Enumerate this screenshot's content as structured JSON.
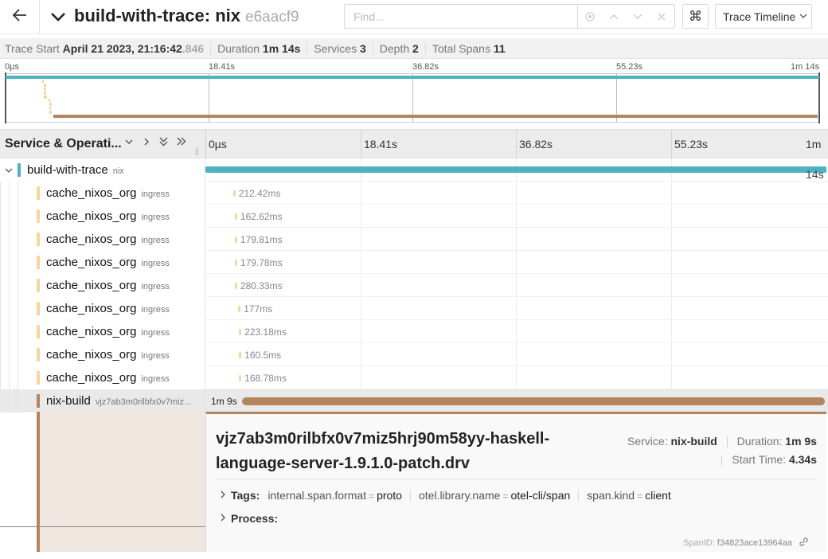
{
  "header": {
    "trace_name": "build-with-trace: nix",
    "trace_id": "e6aacf9",
    "search_placeholder": "Find...",
    "view_label": "Trace Timeline"
  },
  "summary": {
    "start_label": "Trace Start",
    "start_value": "April 21 2023, 21:16:42",
    "start_ms": ".846",
    "duration_label": "Duration",
    "duration_value": "1m 14s",
    "services_label": "Services",
    "services_value": "3",
    "depth_label": "Depth",
    "depth_value": "2",
    "spans_label": "Total Spans",
    "spans_value": "11"
  },
  "minimap_ticks": [
    "0µs",
    "18.41s",
    "36.82s",
    "55.23s",
    "1m 14s"
  ],
  "timeline": {
    "column_title": "Service & Operati...",
    "ticks": [
      "0µs",
      "18.41s",
      "36.82s",
      "55.23s",
      "1m"
    ],
    "root_end_label": "14s"
  },
  "colors": {
    "root": "#4fb3bf",
    "cache": "#f5d79e",
    "nix_build": "#b3865d"
  },
  "rows": [
    {
      "service": "build-with-trace",
      "operation": "nix",
      "duration": "",
      "color": "root",
      "start_s": 0,
      "dur_s": 74
    },
    {
      "service": "cache_nixos_org",
      "operation": "ingress",
      "duration": "212.42ms",
      "color": "cache",
      "start_s": 3.3,
      "dur_s": 0.21
    },
    {
      "service": "cache_nixos_org",
      "operation": "ingress",
      "duration": "162.62ms",
      "color": "cache",
      "start_s": 3.5,
      "dur_s": 0.16
    },
    {
      "service": "cache_nixos_org",
      "operation": "ingress",
      "duration": "179.81ms",
      "color": "cache",
      "start_s": 3.5,
      "dur_s": 0.18
    },
    {
      "service": "cache_nixos_org",
      "operation": "ingress",
      "duration": "179.78ms",
      "color": "cache",
      "start_s": 3.5,
      "dur_s": 0.18
    },
    {
      "service": "cache_nixos_org",
      "operation": "ingress",
      "duration": "280.33ms",
      "color": "cache",
      "start_s": 3.5,
      "dur_s": 0.28
    },
    {
      "service": "cache_nixos_org",
      "operation": "ingress",
      "duration": "177ms",
      "color": "cache",
      "start_s": 3.9,
      "dur_s": 0.18
    },
    {
      "service": "cache_nixos_org",
      "operation": "ingress",
      "duration": "223.18ms",
      "color": "cache",
      "start_s": 4.0,
      "dur_s": 0.22
    },
    {
      "service": "cache_nixos_org",
      "operation": "ingress",
      "duration": "160.5ms",
      "color": "cache",
      "start_s": 4.0,
      "dur_s": 0.16
    },
    {
      "service": "cache_nixos_org",
      "operation": "ingress",
      "duration": "168.78ms",
      "color": "cache",
      "start_s": 4.0,
      "dur_s": 0.17
    },
    {
      "service": "nix-build",
      "operation": "vjz7ab3m0rilbfx0v7miz...",
      "duration": "1m 9s",
      "color": "nix_build",
      "start_s": 4.34,
      "dur_s": 69.5
    }
  ],
  "detail": {
    "title": "vjz7ab3m0rilbfx0v7miz5hrj90m58yy-haskell-language-server-1.9.1.0-patch.drv",
    "service_label": "Service:",
    "service_value": "nix-build",
    "duration_label": "Duration:",
    "duration_value": "1m 9s",
    "start_label": "Start Time:",
    "start_value": "4.34s",
    "tags_label": "Tags:",
    "tags": [
      {
        "key": "internal.span.format",
        "value": "proto"
      },
      {
        "key": "otel.library.name",
        "value": "otel-cli/span"
      },
      {
        "key": "span.kind",
        "value": "client"
      }
    ],
    "process_label": "Process:",
    "span_id_label": "SpanID:",
    "span_id": "f34823ace13964aa"
  }
}
